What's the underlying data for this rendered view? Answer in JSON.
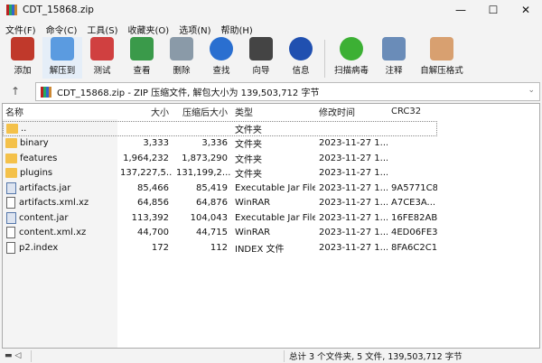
{
  "window": {
    "title": "CDT_15868.zip",
    "minimize": "—",
    "maximize": "☐",
    "close": "✕"
  },
  "menu": [
    "文件(F)",
    "命令(C)",
    "工具(S)",
    "收藏夹(O)",
    "选项(N)",
    "帮助(H)"
  ],
  "toolbar": [
    {
      "label": "添加",
      "icon": "add-archive-icon",
      "color": "#c0392b"
    },
    {
      "label": "解压到",
      "icon": "extract-folder-icon",
      "color": "#5b9be0"
    },
    {
      "label": "测试",
      "icon": "test-clipboard-icon",
      "color": "#d04040"
    },
    {
      "label": "查看",
      "icon": "view-book-icon",
      "color": "#3a9a4a"
    },
    {
      "label": "删除",
      "icon": "delete-trash-icon",
      "color": "#8a9aa8"
    },
    {
      "label": "查找",
      "icon": "find-magnifier-icon",
      "color": "#2a6fd0"
    },
    {
      "label": "向导",
      "icon": "wizard-wand-icon",
      "color": "#444444"
    },
    {
      "label": "信息",
      "icon": "info-icon",
      "color": "#2050b0"
    },
    {
      "label": "扫描病毒",
      "icon": "virus-scan-icon",
      "color": "#3cb034"
    },
    {
      "label": "注释",
      "icon": "comment-icon",
      "color": "#6a8cb8"
    },
    {
      "label": "自解压格式",
      "icon": "sfx-box-icon",
      "color": "#d8a070"
    }
  ],
  "address": {
    "up": "↑",
    "text": "CDT_15868.zip - ZIP 压缩文件, 解包大小为 139,503,712 字节",
    "chevron": "⌄"
  },
  "columns": [
    "名称",
    "大小",
    "压缩后大小",
    "类型",
    "修改时间",
    "CRC32"
  ],
  "rows": [
    {
      "name": "..",
      "size": "",
      "packed": "",
      "type": "文件夹",
      "modified": "",
      "crc": "",
      "kind": "folder"
    },
    {
      "name": "binary",
      "size": "3,333",
      "packed": "3,336",
      "type": "文件夹",
      "modified": "2023-11-27 1...",
      "crc": "",
      "kind": "folder"
    },
    {
      "name": "features",
      "size": "1,964,232",
      "packed": "1,873,290",
      "type": "文件夹",
      "modified": "2023-11-27 1...",
      "crc": "",
      "kind": "folder"
    },
    {
      "name": "plugins",
      "size": "137,227,5...",
      "packed": "131,199,2...",
      "type": "文件夹",
      "modified": "2023-11-27 1...",
      "crc": "",
      "kind": "folder"
    },
    {
      "name": "artifacts.jar",
      "size": "85,466",
      "packed": "85,419",
      "type": "Executable Jar File",
      "modified": "2023-11-27 1...",
      "crc": "9A5771C8",
      "kind": "jar"
    },
    {
      "name": "artifacts.xml.xz",
      "size": "64,856",
      "packed": "64,876",
      "type": "WinRAR",
      "modified": "2023-11-27 1...",
      "crc": "A7CE3A...",
      "kind": "file"
    },
    {
      "name": "content.jar",
      "size": "113,392",
      "packed": "104,043",
      "type": "Executable Jar File",
      "modified": "2023-11-27 1...",
      "crc": "16FE82AB",
      "kind": "jar"
    },
    {
      "name": "content.xml.xz",
      "size": "44,700",
      "packed": "44,715",
      "type": "WinRAR",
      "modified": "2023-11-27 1...",
      "crc": "4ED06FE3",
      "kind": "file"
    },
    {
      "name": "p2.index",
      "size": "172",
      "packed": "112",
      "type": "INDEX 文件",
      "modified": "2023-11-27 1...",
      "crc": "8FA6C2C1",
      "kind": "file"
    }
  ],
  "status": {
    "text": "总计 3 个文件夹, 5 文件, 139,503,712 字节"
  }
}
